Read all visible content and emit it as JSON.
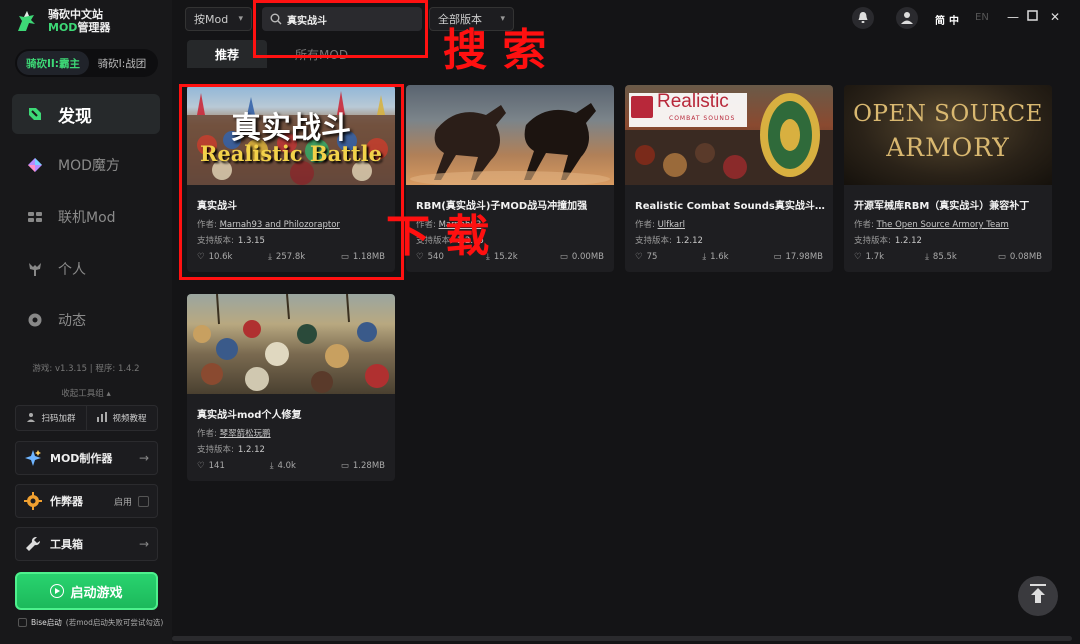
{
  "app": {
    "logo_line1": "骑砍中文站",
    "logo_mod": "MOD",
    "logo_line2_rest": "管理器"
  },
  "game_switch": {
    "active": "骑砍II:霸主",
    "inactive": "骑砍I:战团"
  },
  "nav": [
    {
      "label": "发现",
      "icon": "discover-icon"
    },
    {
      "label": "MOD魔方",
      "icon": "cube-icon"
    },
    {
      "label": "联机Mod",
      "icon": "multiplayer-icon"
    },
    {
      "label": "个人",
      "icon": "person-icon"
    },
    {
      "label": "动态",
      "icon": "feed-icon"
    }
  ],
  "versions": {
    "game_label": "游戏:",
    "game": "v1.3.15",
    "sep": "|",
    "program_label": "程序:",
    "program": "1.4.2"
  },
  "collapse_tools": "收起工具组 ▴",
  "quick_buttons": {
    "group": "扫码加群",
    "tutorial": "视频教程"
  },
  "tools": {
    "mod_maker": "MOD制作器",
    "cheat": "作弊器",
    "cheat_enable": "启用",
    "toolbox": "工具箱"
  },
  "launch": "启动游戏",
  "bise": {
    "label": "Bise启动",
    "hint": "(若mod启动失败可尝试勾选)"
  },
  "header": {
    "sort_dropdown": "按Mod",
    "search_value": "真实战斗",
    "version_dropdown": "全部版本",
    "lang_active": "简",
    "lang_2": "中",
    "lang_3": "EN"
  },
  "tabs": {
    "recommended": "推荐",
    "all": "所有MOD"
  },
  "labels": {
    "author": "作者:",
    "version": "支持版本:"
  },
  "cards": [
    {
      "title": "真实战斗",
      "author": "Marnah93 and Philozoraptor",
      "version": "1.3.15",
      "likes": "10.6k",
      "downloads": "257.8k",
      "size": "1.18MB",
      "banner_cn": "真实战斗",
      "banner_en": "Realistic Battle"
    },
    {
      "title": "RBM(真实战斗)子MOD战马冲撞加强",
      "author": "Marnah93",
      "version": "1.2.15",
      "likes": "540",
      "downloads": "15.2k",
      "size": "0.00MB"
    },
    {
      "title": "Realistic Combat Sounds真实战斗声...",
      "author": "Ulfkarl",
      "version": "1.2.12",
      "likes": "75",
      "downloads": "1.6k",
      "size": "17.98MB",
      "banner_title": "Realistic",
      "banner_sub": "COMBAT SOUNDS"
    },
    {
      "title": "开源军械库RBM（真实战斗）兼容补丁",
      "author": "The Open Source Armory Team",
      "version": "1.2.12",
      "likes": "1.7k",
      "downloads": "85.5k",
      "size": "0.08MB",
      "banner_l1": "OPEN SOURCE",
      "banner_l2": "ARMORY"
    },
    {
      "title": "真实战斗mod个人修复",
      "author": "琴翠箭松玩鹏",
      "version": "1.2.12",
      "likes": "141",
      "downloads": "4.0k",
      "size": "1.28MB"
    }
  ],
  "annotations": {
    "search": "搜 索",
    "download": "下 载"
  },
  "colors": {
    "accent": "#3dd876",
    "annotation": "#ff1111"
  }
}
